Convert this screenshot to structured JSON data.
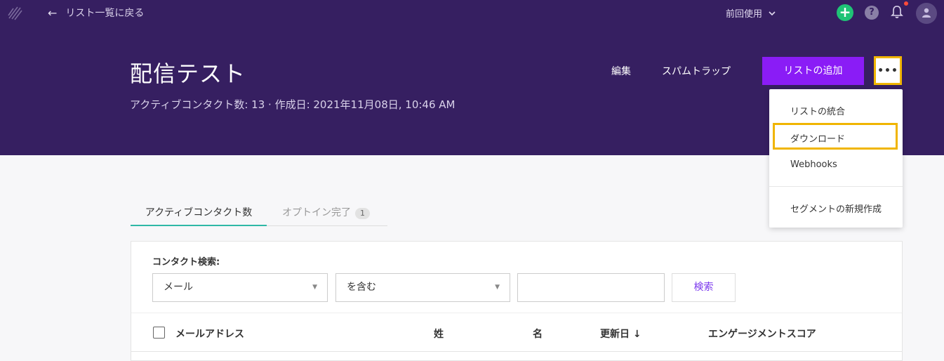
{
  "topbar": {
    "back_label": "リスト一覧に戻る",
    "recent_label": "前回使用"
  },
  "header": {
    "title": "配信テスト",
    "subtitle": "アクティブコンタクト数: 13 · 作成日: 2021年11月08日, 10:46 AM",
    "edit_label": "編集",
    "spam_label": "スパムトラップ",
    "add_list_label": "リストの追加",
    "more_label": "•••"
  },
  "dropdown": {
    "items": [
      "リストの統合",
      "ダウンロード",
      "Webhooks",
      "セグメントの新規作成"
    ]
  },
  "tabs": [
    {
      "label": "アクティブコンタクト数"
    },
    {
      "label": "オプトイン完了",
      "count": "1"
    }
  ],
  "search": {
    "label": "コンタクト検索:",
    "field_select": "メール",
    "operator_select": "を含む",
    "value": "",
    "button_label": "検索"
  },
  "table": {
    "columns": [
      "メールアドレス",
      "姓",
      "名",
      "更新日 ↓",
      "エンゲージメントスコア"
    ]
  },
  "colors": {
    "header_bg": "#361f61",
    "accent": "#8a1cf6",
    "tab_underline": "#2fb8a6",
    "highlight": "#f0b500",
    "plus_green": "#1fc376"
  }
}
